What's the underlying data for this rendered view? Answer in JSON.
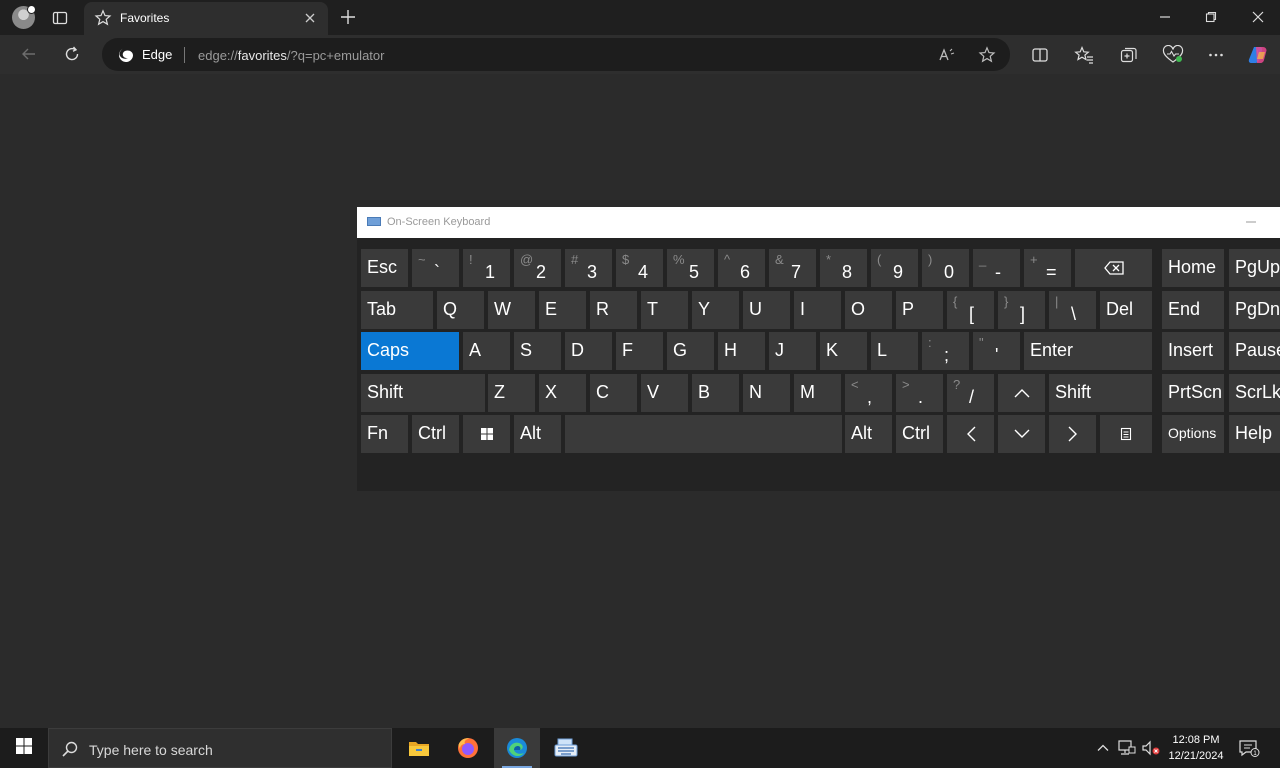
{
  "browser": {
    "tab": {
      "title": "Favorites"
    },
    "omnibox": {
      "site": "Edge",
      "url_prefix": "edge://",
      "url_main": "favorites",
      "url_suffix": "/?q=pc+emulator"
    }
  },
  "osk": {
    "title": "On-Screen Keyboard",
    "selected_key": "Caps",
    "rows": [
      {
        "keys": [
          {
            "label": "Esc"
          },
          {
            "shift": "~",
            "base": "`"
          },
          {
            "shift": "!",
            "base": "1"
          },
          {
            "shift": "@",
            "base": "2"
          },
          {
            "shift": "#",
            "base": "3"
          },
          {
            "shift": "$",
            "base": "4"
          },
          {
            "shift": "%",
            "base": "5"
          },
          {
            "shift": "^",
            "base": "6"
          },
          {
            "shift": "&",
            "base": "7"
          },
          {
            "shift": "*",
            "base": "8"
          },
          {
            "shift": "(",
            "base": "9"
          },
          {
            "shift": ")",
            "base": "0"
          },
          {
            "shift": "_",
            "base": "-"
          },
          {
            "shift": "+",
            "base": "="
          },
          {
            "icon": "backspace-icon"
          },
          {
            "label": "Home"
          },
          {
            "label": "PgUp"
          }
        ]
      },
      {
        "keys": [
          {
            "label": "Tab"
          },
          {
            "label": "Q"
          },
          {
            "label": "W"
          },
          {
            "label": "E"
          },
          {
            "label": "R"
          },
          {
            "label": "T"
          },
          {
            "label": "Y"
          },
          {
            "label": "U"
          },
          {
            "label": "I"
          },
          {
            "label": "O"
          },
          {
            "label": "P"
          },
          {
            "shift": "{",
            "base": "["
          },
          {
            "shift": "}",
            "base": "]"
          },
          {
            "shift": "|",
            "base": "\\"
          },
          {
            "label": "Del"
          },
          {
            "label": "End"
          },
          {
            "label": "PgDn"
          }
        ]
      },
      {
        "keys": [
          {
            "label": "Caps"
          },
          {
            "label": "A"
          },
          {
            "label": "S"
          },
          {
            "label": "D"
          },
          {
            "label": "F"
          },
          {
            "label": "G"
          },
          {
            "label": "H"
          },
          {
            "label": "J"
          },
          {
            "label": "K"
          },
          {
            "label": "L"
          },
          {
            "shift": ":",
            "base": ";"
          },
          {
            "shift": "\"",
            "base": "'"
          },
          {
            "label": "Enter"
          },
          {
            "label": "Insert"
          },
          {
            "label": "Pause"
          }
        ]
      },
      {
        "keys": [
          {
            "label": "Shift"
          },
          {
            "label": "Z"
          },
          {
            "label": "X"
          },
          {
            "label": "C"
          },
          {
            "label": "V"
          },
          {
            "label": "B"
          },
          {
            "label": "N"
          },
          {
            "label": "M"
          },
          {
            "shift": "<",
            "base": ","
          },
          {
            "shift": ">",
            "base": "."
          },
          {
            "shift": "?",
            "base": "/"
          },
          {
            "icon": "arrow-up-icon"
          },
          {
            "label": "Shift"
          },
          {
            "label": "PrtScn"
          },
          {
            "label": "ScrLk"
          }
        ]
      },
      {
        "keys": [
          {
            "label": "Fn"
          },
          {
            "label": "Ctrl"
          },
          {
            "icon": "windows-icon"
          },
          {
            "label": "Alt"
          },
          {
            "label": ""
          },
          {
            "label": "Alt"
          },
          {
            "label": "Ctrl"
          },
          {
            "icon": "arrow-left-icon"
          },
          {
            "icon": "arrow-down-icon"
          },
          {
            "icon": "arrow-right-icon"
          },
          {
            "icon": "menu-key-icon"
          },
          {
            "label": "Options"
          },
          {
            "label": "Help"
          }
        ]
      }
    ]
  },
  "taskbar": {
    "search_placeholder": "Type here to search",
    "apps": [
      "file-explorer-icon",
      "firefox-icon",
      "edge-icon",
      "on-screen-keyboard-icon"
    ],
    "clock": {
      "time": "12:08 PM",
      "date": "12/21/2024"
    },
    "accent": "#0a78d4"
  }
}
